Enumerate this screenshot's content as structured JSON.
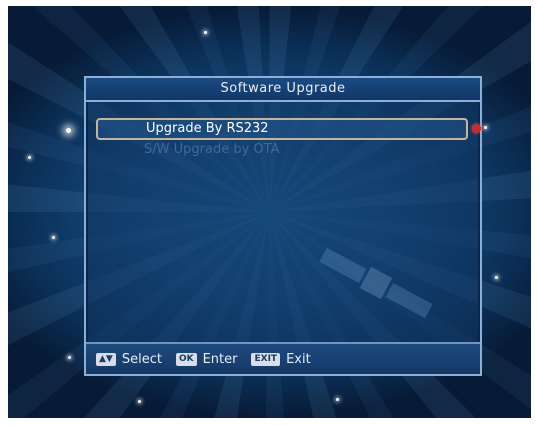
{
  "dialog": {
    "title": "Software Upgrade",
    "menu_items": [
      {
        "label": "Upgrade By RS232",
        "selected": true
      },
      {
        "label": "S/W Upgrade by OTA",
        "selected": false
      }
    ]
  },
  "footer": {
    "hints": [
      {
        "key": "▲▼",
        "label": "Select",
        "icon": "arrow-keys-icon"
      },
      {
        "key": "OK",
        "label": "Enter",
        "icon": "ok-key-icon"
      },
      {
        "key": "EXIT",
        "label": "Exit",
        "icon": "exit-key-icon"
      }
    ]
  },
  "colors": {
    "selected_text": "#ffffff",
    "unselected_text": "#3c6a99",
    "marker": "#cc2a2a",
    "frame": "#8ab0d8"
  }
}
